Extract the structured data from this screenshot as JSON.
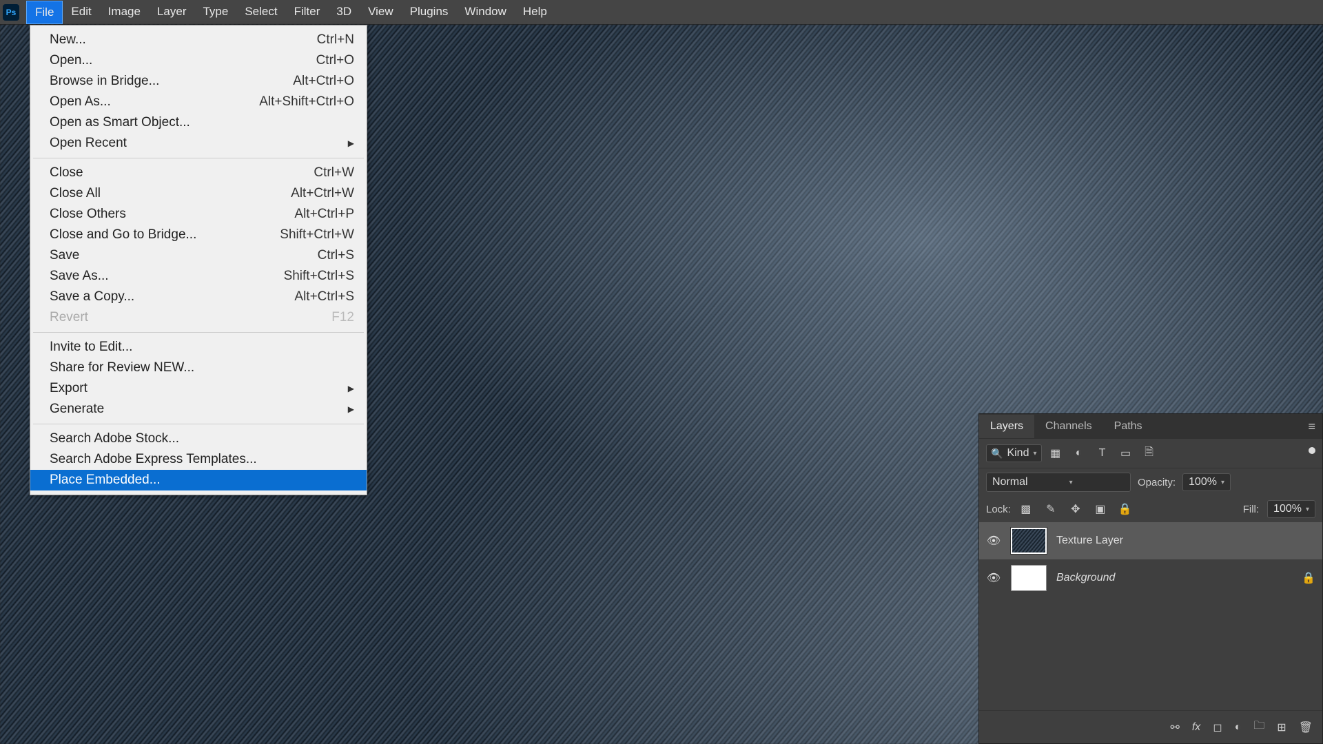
{
  "app": {
    "logo": "Ps"
  },
  "menubar": {
    "items": [
      "File",
      "Edit",
      "Image",
      "Layer",
      "Type",
      "Select",
      "Filter",
      "3D",
      "View",
      "Plugins",
      "Window",
      "Help"
    ],
    "active_index": 0
  },
  "file_menu": {
    "groups": [
      [
        {
          "label": "New...",
          "shortcut": "Ctrl+N"
        },
        {
          "label": "Open...",
          "shortcut": "Ctrl+O"
        },
        {
          "label": "Browse in Bridge...",
          "shortcut": "Alt+Ctrl+O"
        },
        {
          "label": "Open As...",
          "shortcut": "Alt+Shift+Ctrl+O"
        },
        {
          "label": "Open as Smart Object...",
          "shortcut": ""
        },
        {
          "label": "Open Recent",
          "shortcut": "",
          "submenu": true
        }
      ],
      [
        {
          "label": "Close",
          "shortcut": "Ctrl+W"
        },
        {
          "label": "Close All",
          "shortcut": "Alt+Ctrl+W"
        },
        {
          "label": "Close Others",
          "shortcut": "Alt+Ctrl+P"
        },
        {
          "label": "Close and Go to Bridge...",
          "shortcut": "Shift+Ctrl+W"
        },
        {
          "label": "Save",
          "shortcut": "Ctrl+S"
        },
        {
          "label": "Save As...",
          "shortcut": "Shift+Ctrl+S"
        },
        {
          "label": "Save a Copy...",
          "shortcut": "Alt+Ctrl+S"
        },
        {
          "label": "Revert",
          "shortcut": "F12",
          "disabled": true
        }
      ],
      [
        {
          "label": "Invite to Edit...",
          "shortcut": ""
        },
        {
          "label": "Share for Review NEW...",
          "shortcut": ""
        },
        {
          "label": "Export",
          "shortcut": "",
          "submenu": true
        },
        {
          "label": "Generate",
          "shortcut": "",
          "submenu": true
        }
      ],
      [
        {
          "label": "Search Adobe Stock...",
          "shortcut": ""
        },
        {
          "label": "Search Adobe Express Templates...",
          "shortcut": ""
        },
        {
          "label": "Place Embedded...",
          "shortcut": "",
          "highlighted": true
        }
      ]
    ]
  },
  "layers_panel": {
    "tabs": [
      "Layers",
      "Channels",
      "Paths"
    ],
    "active_tab": 0,
    "filter_kind": "Kind",
    "blend_mode": "Normal",
    "opacity_label": "Opacity:",
    "opacity_value": "100%",
    "fill_label": "Fill:",
    "fill_value": "100%",
    "lock_label": "Lock:",
    "layers": [
      {
        "name": "Texture Layer",
        "selected": true,
        "locked": false,
        "fabric": true
      },
      {
        "name": "Background",
        "selected": false,
        "locked": true,
        "italic": true
      }
    ]
  }
}
